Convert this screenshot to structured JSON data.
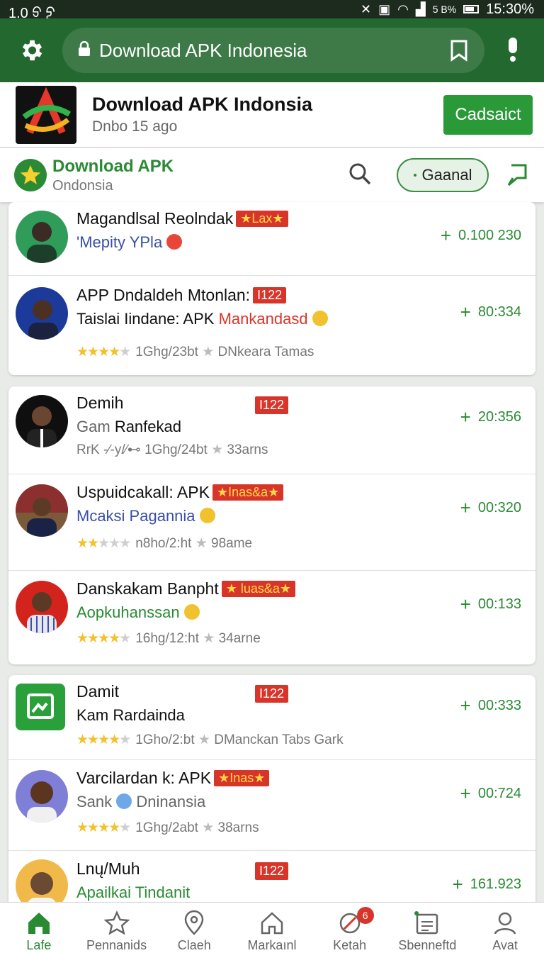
{
  "status_bar": {
    "left_text": "1.0 ᢒ ᢓ",
    "battery_pct": "5 B%",
    "time": "15:30%"
  },
  "app_bar": {
    "url_text": "Download APK Indonesia"
  },
  "app_card": {
    "title": "Download APK Indonsia",
    "subtitle": "Dnbo 15 ago",
    "button_label": "Cadsaict"
  },
  "header": {
    "title": "Download APK",
    "subtitle": "Ondonsia",
    "chip_label": "Gaanal"
  },
  "colors": {
    "brand_green": "#23692f",
    "accent_green": "#2a9a38",
    "badge_red": "#d8352a",
    "star_gold": "#f2c12e"
  },
  "list": [
    {
      "line1": "Magandlsal Reolndak",
      "badge": "★Lax★",
      "line2": "'Mepity YPla",
      "line2_color": "#3a4fa8",
      "count": "0.100 230",
      "rating": 0
    },
    {
      "line1": "APP Dndaldeh Mtonlan:",
      "badge": "I122",
      "line2_a": "Taislai Iindane: APK",
      "line2_b": "Mankandasd",
      "line3": "1Ghg/23bt",
      "line3_b": "DNkeara Tamas",
      "count": "80:334",
      "rating": 4.5
    },
    {
      "line1": "Demih",
      "badge": "I122",
      "line2_a": "Gam",
      "line2_b": "Ranfekad",
      "line3_prefix": "RrK -∕-y/∕⊷",
      "line3": "1Ghg/24bt",
      "line3_b": "33arns",
      "count": "20:356"
    },
    {
      "line1": "Uspuidcakall: APK",
      "badge": "★Inas&a★",
      "line2": "Mcaksi Pagannia",
      "line2_color": "#3a4fa8",
      "line3": "n8ho/2:ht",
      "line3_b": "98ame",
      "count": "00:320",
      "rating": 2.5
    },
    {
      "line1": "Danskakam Banpht",
      "badge": "★ luas&a★",
      "line2": "Aopkuhanssan",
      "line2_color": "#2a8a34",
      "line3": "16hg/12:ht",
      "line3_b": "34arne",
      "count": "00:133",
      "rating": 4.5
    },
    {
      "line1": "Damit",
      "badge": "I122",
      "line2": "Kam Rardainda",
      "line2_color": "#111",
      "line3": "1Gho/2:bt",
      "line3_b": "DManckan Tabs Gark",
      "count": "00:333",
      "rating": 4.5
    },
    {
      "line1": "Varcilardan k: APK",
      "badge": "★Inas★",
      "line2_a": "Sank",
      "line2_b": "Dninansia",
      "line3": "1Ghg/2abt",
      "line3_b": "38arns",
      "count": "00:724",
      "rating": 4.5
    },
    {
      "line1": "Lnų/Muh",
      "badge": "I122",
      "line2": "Apailkai Tindanit",
      "line2_color": "#2a8a34",
      "count": "161.923"
    }
  ],
  "bottom_nav": [
    {
      "label": "Lafe",
      "icon": "home-icon",
      "active": true
    },
    {
      "label": "Pennanids",
      "icon": "star-icon"
    },
    {
      "label": "Claeh",
      "icon": "heart-icon"
    },
    {
      "label": "Markaınl",
      "icon": "house-outline-icon"
    },
    {
      "label": "Ketah",
      "icon": "no-entry-icon",
      "badge": "6"
    },
    {
      "label": "Sbenneftd",
      "icon": "calendar-icon"
    },
    {
      "label": "Avat",
      "icon": "user-icon"
    }
  ]
}
